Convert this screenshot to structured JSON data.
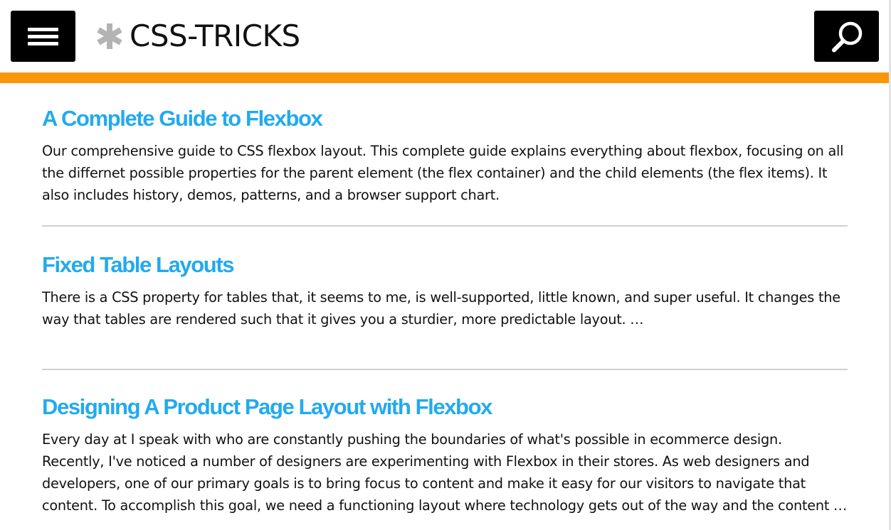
{
  "site": {
    "logo_text": "CSS-TRICKS",
    "colors": {
      "accent": "#f89709",
      "link": "#22aaee",
      "logo_star": "#b3b3b3",
      "header_button_bg": "#000000"
    },
    "icons": {
      "menu": "hamburger-menu-icon",
      "search": "search-icon",
      "logo": "asterisk-star-icon"
    }
  },
  "articles": [
    {
      "title": "A Complete Guide to Flexbox",
      "excerpt": "Our comprehensive guide to CSS flexbox layout. This complete guide explains everything about flexbox, focusing on all the differnet possible properties for the parent element (the flex container) and the child elements (the flex items). It also includes history, demos, patterns, and a browser support chart."
    },
    {
      "title": "Fixed Table Layouts",
      "excerpt": "There is a CSS property for tables that, it seems to me, is well-supported, little known, and super useful. It changes the way that tables are rendered such that it gives you a sturdier, more predictable layout. …"
    },
    {
      "title": "Designing A Product Page Layout with Flexbox",
      "excerpt": "Every day at I speak with who are constantly pushing the boundaries of what's possible in ecommerce design. Recently, I've noticed a number of designers are experimenting with Flexbox in their stores. As web designers and developers, one of our primary goals is to bring focus to content and make it easy for our visitors to navigate that content. To accomplish this goal, we need a functioning layout where technology gets out of the way and the content …"
    }
  ]
}
